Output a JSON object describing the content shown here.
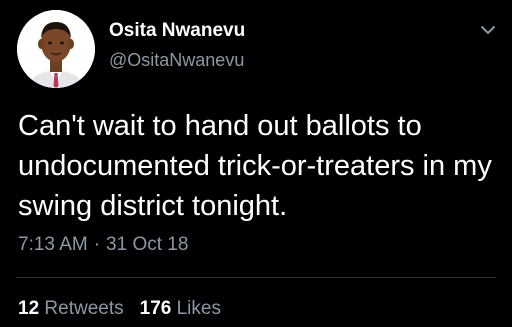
{
  "tweet": {
    "author": {
      "name": "Osita Nwanevu",
      "handle": "@OsitaNwanevu",
      "avatar_icon": "cartoon-avatar-icon"
    },
    "menu_icon": "chevron-down-icon",
    "text": "Can't wait to hand out ballots to undocumented trick-or-treaters in my swing district tonight.",
    "time": "7:13 AM",
    "separator": "·",
    "date": "31 Oct 18",
    "stats": {
      "retweets_count": "12",
      "retweets_label": "Retweets",
      "likes_count": "176",
      "likes_label": "Likes"
    }
  },
  "colors": {
    "background": "#000000",
    "primary_text": "#ffffff",
    "secondary_text": "#8b98a5",
    "divider": "#2f3336"
  }
}
